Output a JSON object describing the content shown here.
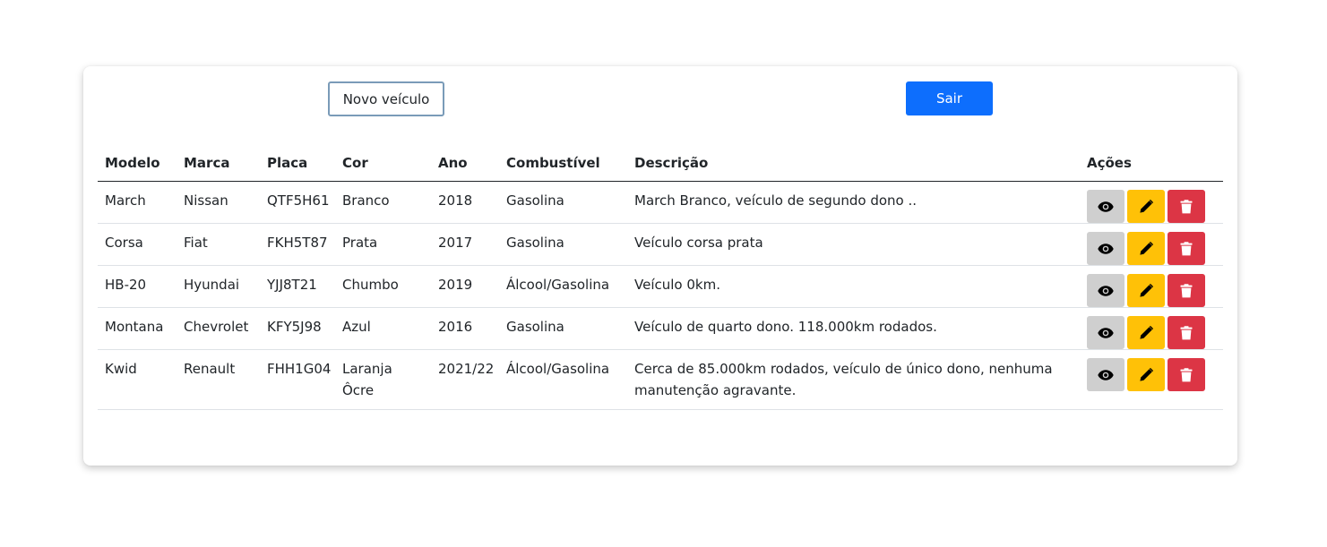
{
  "toolbar": {
    "new_vehicle_label": "Novo veículo",
    "logout_label": "Sair"
  },
  "table": {
    "headers": [
      "Modelo",
      "Marca",
      "Placa",
      "Cor",
      "Ano",
      "Combustível",
      "Descrição",
      "Ações"
    ],
    "rows": [
      {
        "modelo": "March",
        "marca": "Nissan",
        "placa": "QTF5H61",
        "cor": "Branco",
        "ano": "2018",
        "combustivel": "Gasolina",
        "descricao": "March Branco, veículo de segundo dono .."
      },
      {
        "modelo": "Corsa",
        "marca": "Fiat",
        "placa": "FKH5T87",
        "cor": "Prata",
        "ano": "2017",
        "combustivel": "Gasolina",
        "descricao": "Veículo corsa prata"
      },
      {
        "modelo": "HB-20",
        "marca": "Hyundai",
        "placa": "YJJ8T21",
        "cor": "Chumbo",
        "ano": "2019",
        "combustivel": "Álcool/Gasolina",
        "descricao": "Veículo 0km."
      },
      {
        "modelo": "Montana",
        "marca": "Chevrolet",
        "placa": "KFY5J98",
        "cor": "Azul",
        "ano": "2016",
        "combustivel": "Gasolina",
        "descricao": "Veículo de quarto dono. 118.000km rodados."
      },
      {
        "modelo": "Kwid",
        "marca": "Renault",
        "placa": "FHH1G04",
        "cor": "Laranja Ôcre",
        "ano": "2021/22",
        "combustivel": "Álcool/Gasolina",
        "descricao": "Cerca de 85.000km rodados, veículo de único dono, nenhuma manutenção agravante."
      }
    ],
    "row_actions": [
      "eye-icon",
      "pencil-icon",
      "trash-icon"
    ]
  },
  "colors": {
    "primary": "#0d6efd",
    "view_button": "#cfcfcf",
    "edit_button": "#ffc107",
    "delete_button": "#dc3545",
    "new_vehicle_border": "#7a9bb8"
  }
}
